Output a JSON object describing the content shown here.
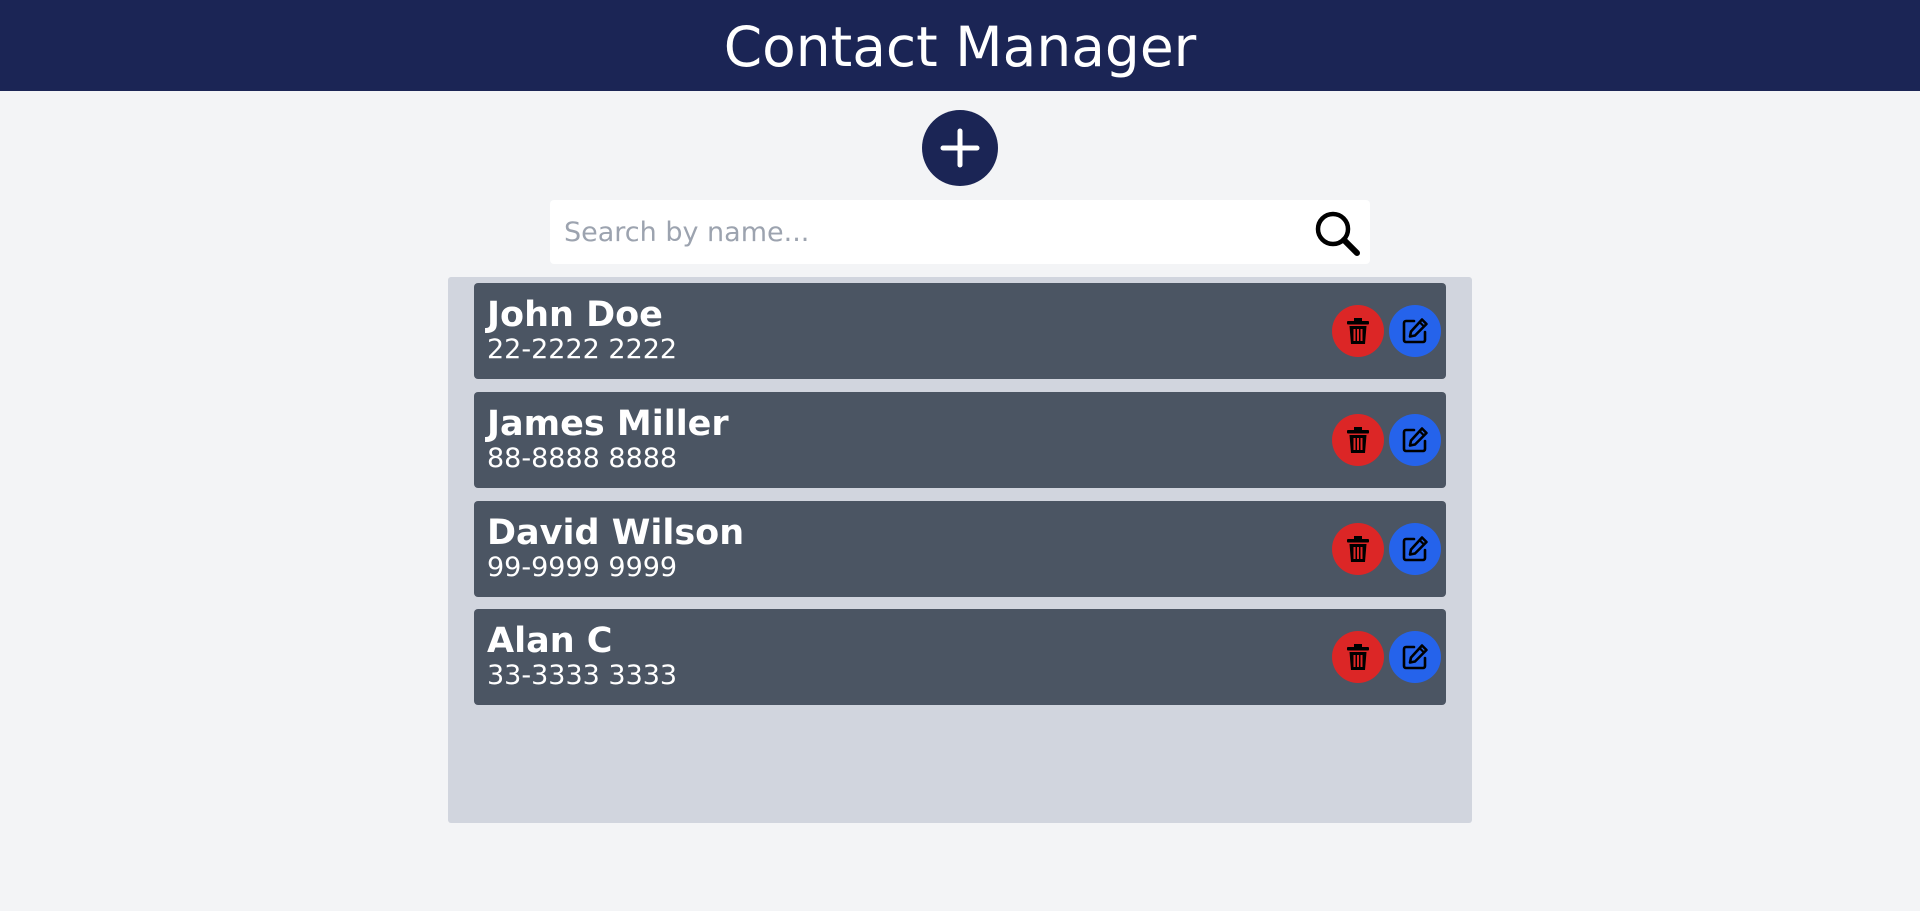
{
  "app": {
    "title": "Contact Manager"
  },
  "search": {
    "placeholder": "Search by name...",
    "value": ""
  },
  "contacts": [
    {
      "name": "John Doe",
      "phone": "22-2222 2222"
    },
    {
      "name": "James Miller",
      "phone": "88-8888 8888"
    },
    {
      "name": "David Wilson",
      "phone": "99-9999 9999"
    },
    {
      "name": "Alan C",
      "phone": "33-3333 3333"
    }
  ],
  "icons": {
    "add": "plus-icon",
    "search": "search-icon",
    "delete": "trash-icon",
    "edit": "edit-icon"
  },
  "colors": {
    "header_bg": "#1b2555",
    "page_bg": "#f3f4f6",
    "panel_bg": "#d1d5de",
    "card_bg": "#4b5563",
    "delete": "#dc2626",
    "edit": "#2563eb"
  }
}
